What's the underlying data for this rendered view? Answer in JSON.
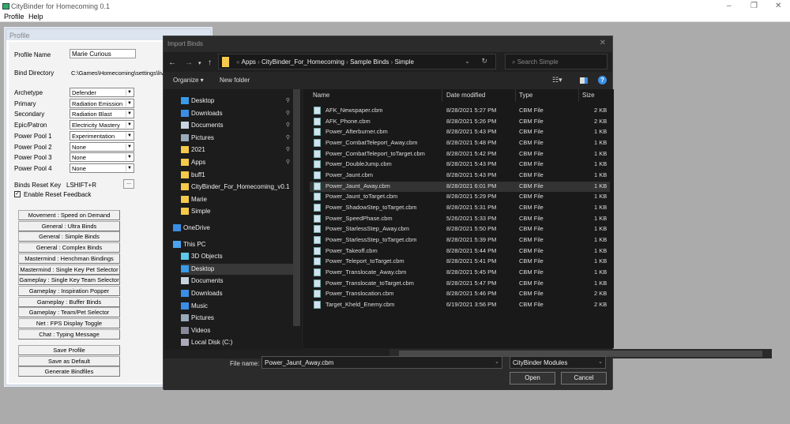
{
  "app": {
    "title": "CityBinder for Homecoming 0.1",
    "menu": [
      "Profile",
      "Help"
    ]
  },
  "profile": {
    "title": "Profile",
    "profile_name_label": "Profile Name",
    "profile_name": "Marie Curious",
    "bind_dir_label": "Bind Directory",
    "bind_dir": "C:\\Games\\Homecoming\\settings\\live\\b",
    "selects": [
      {
        "label": "Archetype",
        "value": "Defender"
      },
      {
        "label": "Primary",
        "value": "Radiation Emission"
      },
      {
        "label": "Secondary",
        "value": "Radiation Blast"
      },
      {
        "label": "Epic/Patron",
        "value": "Electricity Mastery"
      },
      {
        "label": "Power Pool 1",
        "value": "Experimentation"
      },
      {
        "label": "Power Pool 2",
        "value": "None"
      },
      {
        "label": "Power Pool 3",
        "value": "None"
      },
      {
        "label": "Power Pool 4",
        "value": "None"
      }
    ],
    "reset_key_label": "Binds Reset Key",
    "reset_key": "LSHIFT+R",
    "reset_key_button": "...",
    "reset_feedback_label": "Enable Reset Feedback",
    "reset_feedback_checked": true,
    "modules": [
      "Movement : Speed on Demand",
      "General : Ultra Binds",
      "General : Simple Binds",
      "General : Complex Binds",
      "Mastermind : Henchman Bindings",
      "Mastermind : Single Key Pet Selector",
      "Gameplay : Single Key Team Selector",
      "Gameplay : Inspiration Popper",
      "Gameplay : Buffer Binds",
      "Gameplay : Team/Pet Selector",
      "Net : FPS Display Toggle",
      "Chat : Typing Message"
    ],
    "actions": [
      "Save Profile",
      "Save as Default",
      "Generate Bindfiles"
    ]
  },
  "dialog": {
    "title": "Import Binds",
    "breadcrumb": [
      "Apps",
      "CityBinder_For_Homecoming",
      "Sample Binds",
      "Simple"
    ],
    "search_placeholder": "Search Simple",
    "organize": "Organize ▾",
    "new_folder": "New folder",
    "nav": [
      {
        "label": "Desktop",
        "icon": "desktop",
        "pinned": true
      },
      {
        "label": "Downloads",
        "icon": "download",
        "pinned": true
      },
      {
        "label": "Documents",
        "icon": "document",
        "pinned": true
      },
      {
        "label": "Pictures",
        "icon": "picture",
        "pinned": true
      },
      {
        "label": "2021",
        "icon": "folder",
        "pinned": true
      },
      {
        "label": "Apps",
        "icon": "folder",
        "pinned": true
      },
      {
        "label": "buff1",
        "icon": "folder"
      },
      {
        "label": "CityBinder_For_Homecoming_v0.1",
        "icon": "folder"
      },
      {
        "label": "Marie",
        "icon": "folder"
      },
      {
        "label": "Simple",
        "icon": "folder"
      },
      {
        "label": "OneDrive",
        "icon": "cloud"
      },
      {
        "label": "This PC",
        "icon": "pc"
      },
      {
        "label": "3D Objects",
        "icon": "cube"
      },
      {
        "label": "Desktop",
        "icon": "desktop",
        "selected": true
      },
      {
        "label": "Documents",
        "icon": "document"
      },
      {
        "label": "Downloads",
        "icon": "download"
      },
      {
        "label": "Music",
        "icon": "music"
      },
      {
        "label": "Pictures",
        "icon": "picture"
      },
      {
        "label": "Videos",
        "icon": "video"
      },
      {
        "label": "Local Disk (C:)",
        "icon": "disk"
      }
    ],
    "columns": [
      "Name",
      "Date modified",
      "Type",
      "Size"
    ],
    "files": [
      [
        "AFK_Newspaper.cbm",
        "8/28/2021 5:27 PM",
        "CBM File",
        "2 KB"
      ],
      [
        "AFK_Phone.cbm",
        "8/28/2021 5:26 PM",
        "CBM File",
        "2 KB"
      ],
      [
        "Power_Afterburner.cbm",
        "8/28/2021 5:43 PM",
        "CBM File",
        "1 KB"
      ],
      [
        "Power_CombatTeleport_Away.cbm",
        "8/28/2021 5:48 PM",
        "CBM File",
        "1 KB"
      ],
      [
        "Power_CombatTeleport_toTarget.cbm",
        "8/28/2021 5:42 PM",
        "CBM File",
        "1 KB"
      ],
      [
        "Power_DoubleJump.cbm",
        "8/28/2021 5:43 PM",
        "CBM File",
        "1 KB"
      ],
      [
        "Power_Jaunt.cbm",
        "8/28/2021 5:43 PM",
        "CBM File",
        "1 KB"
      ],
      [
        "Power_Jaunt_Away.cbm",
        "8/28/2021 6:01 PM",
        "CBM File",
        "1 KB"
      ],
      [
        "Power_Jaunt_toTarget.cbm",
        "8/28/2021 5:29 PM",
        "CBM File",
        "1 KB"
      ],
      [
        "Power_ShadowStep_toTarget.cbm",
        "8/28/2021 5:31 PM",
        "CBM File",
        "1 KB"
      ],
      [
        "Power_SpeedPhase.cbm",
        "5/26/2021 5:33 PM",
        "CBM File",
        "1 KB"
      ],
      [
        "Power_StarlessStep_Away.cbm",
        "8/28/2021 5:50 PM",
        "CBM File",
        "1 KB"
      ],
      [
        "Power_StarlessStep_toTarget.cbm",
        "8/28/2021 5:39 PM",
        "CBM File",
        "1 KB"
      ],
      [
        "Power_Takeoff.cbm",
        "8/28/2021 5:44 PM",
        "CBM File",
        "1 KB"
      ],
      [
        "Power_Teleport_toTarget.cbm",
        "8/28/2021 5:41 PM",
        "CBM File",
        "1 KB"
      ],
      [
        "Power_Translocate_Away.cbm",
        "8/28/2021 5:45 PM",
        "CBM File",
        "1 KB"
      ],
      [
        "Power_Translocate_toTarget.cbm",
        "8/28/2021 5:47 PM",
        "CBM File",
        "1 KB"
      ],
      [
        "Power_Translocation.cbm",
        "8/28/2021 5:46 PM",
        "CBM File",
        "2 KB"
      ],
      [
        "Target_Kheld_Enemy.cbm",
        "6/19/2021 3:56 PM",
        "CBM File",
        "2 KB"
      ]
    ],
    "selected_file_index": 7,
    "file_name_label": "File name:",
    "file_name": "Power_Jaunt_Away.cbm",
    "file_type": "CityBinder Modules",
    "open": "Open",
    "cancel": "Cancel"
  },
  "colors": {
    "accent": "#3a8ee6",
    "folder": "#f5c94a",
    "dialog_bg": "#202020"
  }
}
